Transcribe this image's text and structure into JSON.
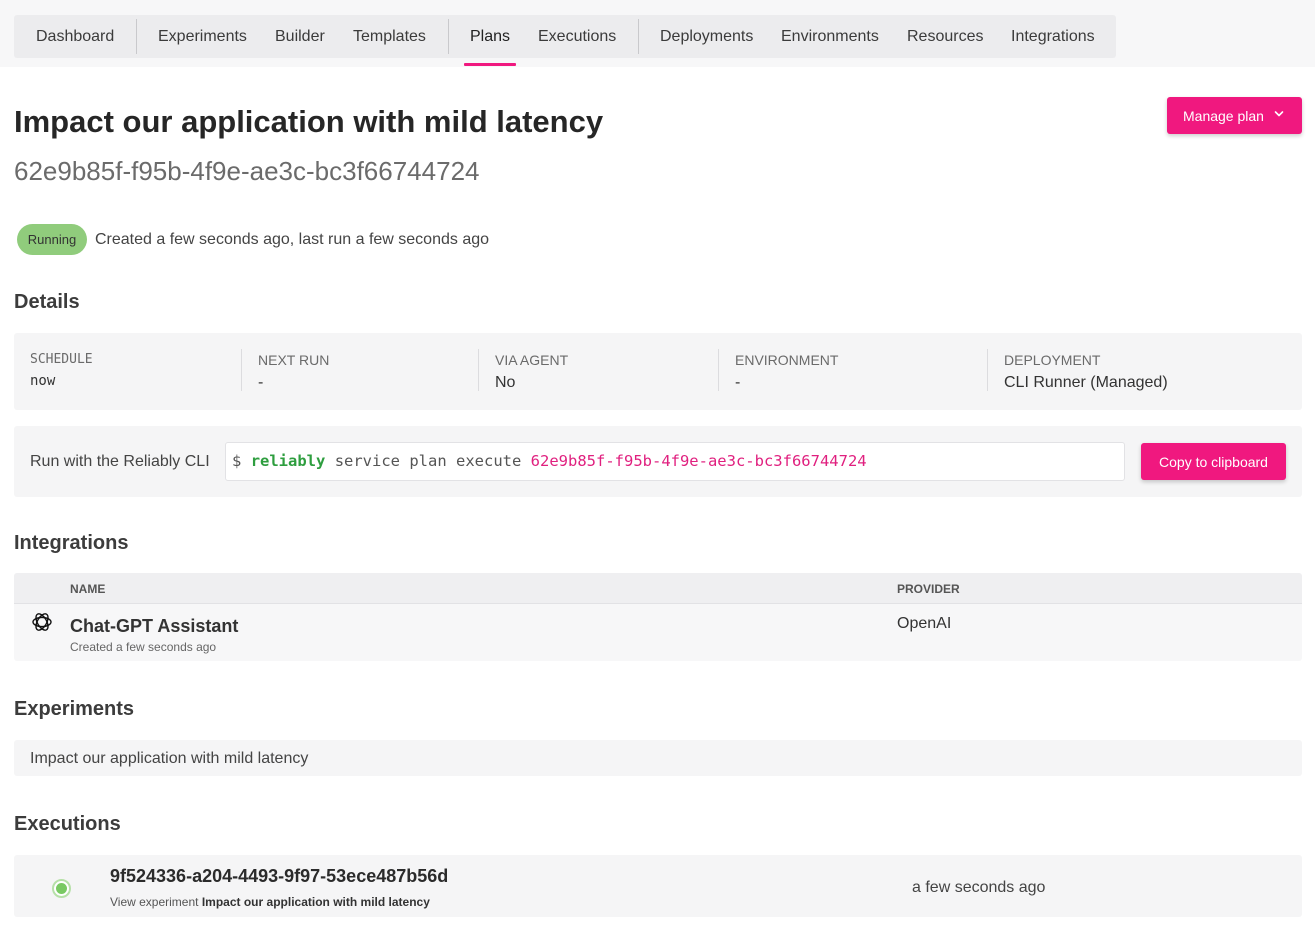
{
  "nav": {
    "items": [
      {
        "label": "Dashboard"
      },
      {
        "label": "Experiments"
      },
      {
        "label": "Builder"
      },
      {
        "label": "Templates"
      },
      {
        "label": "Plans",
        "active": true
      },
      {
        "label": "Executions"
      },
      {
        "label": "Deployments"
      },
      {
        "label": "Environments"
      },
      {
        "label": "Resources"
      },
      {
        "label": "Integrations"
      }
    ]
  },
  "header": {
    "title": "Impact our application with mild latency",
    "plan_id": "62e9b85f-f95b-4f9e-ae3c-bc3f66744724",
    "manage_label": "Manage plan"
  },
  "status": {
    "badge": "Running",
    "text": "Created a few seconds ago, last run a few seconds ago"
  },
  "details": {
    "heading": "Details",
    "schedule_label": "SCHEDULE",
    "schedule_value": "now",
    "next_run_label": "NEXT RUN",
    "next_run_value": "-",
    "via_agent_label": "VIA AGENT",
    "via_agent_value": "No",
    "environment_label": "ENVIRONMENT",
    "environment_value": "-",
    "deployment_label": "DEPLOYMENT",
    "deployment_value": "CLI Runner (Managed)"
  },
  "cli": {
    "label": "Run with the Reliably CLI",
    "prompt": "$",
    "command": "reliably",
    "args": "service plan execute",
    "plan_id": "62e9b85f-f95b-4f9e-ae3c-bc3f66744724",
    "copy_label": "Copy to clipboard"
  },
  "integrations": {
    "heading": "Integrations",
    "col_name": "NAME",
    "col_provider": "PROVIDER",
    "rows": [
      {
        "name": "Chat-GPT Assistant",
        "created": "Created a few seconds ago",
        "provider": "OpenAI",
        "icon": "openai-icon"
      }
    ]
  },
  "experiments": {
    "heading": "Experiments",
    "items": [
      "Impact our application with mild latency"
    ]
  },
  "executions": {
    "heading": "Executions",
    "rows": [
      {
        "id": "9f524336-a204-4493-9f97-53ece487b56d",
        "view_prefix": "View experiment",
        "experiment": "Impact our application with mild latency",
        "time": "a few seconds ago"
      }
    ]
  },
  "colors": {
    "accent": "#f0187f",
    "running": "#90cc7c",
    "cli_command": "#2e9e3f"
  }
}
